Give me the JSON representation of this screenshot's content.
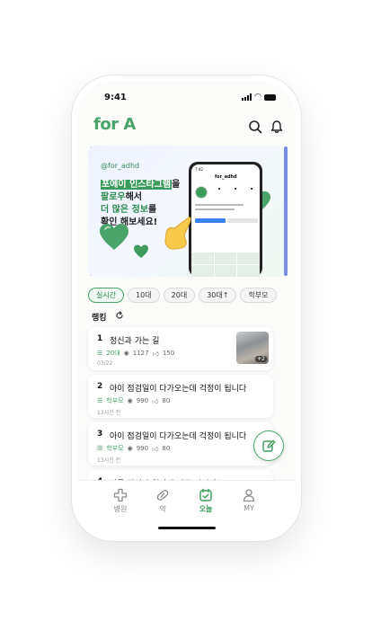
{
  "status": {
    "time": "9:41"
  },
  "header": {
    "logo": "for A"
  },
  "banner": {
    "handle": "@for_adhd",
    "line1_highlight": "포에이 인스타그램",
    "line1_rest": "을",
    "line2_highlight": "팔로우",
    "line2_rest": "해서",
    "line3_highlight1": "더 많은 정보",
    "line3_rest": "를",
    "line4": "확인 해보세요!",
    "mock_time": "7:42",
    "mock_user": "for_adhd"
  },
  "filters": {
    "items": [
      "실시간",
      "10대",
      "20대",
      "30대↑",
      "학부모"
    ],
    "selected": "실시간"
  },
  "ranking": {
    "title": "랭킹",
    "items": [
      {
        "rank": "1",
        "title": "정신과 가는 길",
        "category": "20대",
        "views": "1127",
        "likes": "150",
        "time": "03/22",
        "thumb_count": "+2"
      },
      {
        "rank": "2",
        "title": "아이 점검일이 다가오는데 걱정이 됩니다",
        "category": "학부모",
        "views": "990",
        "likes": "80",
        "time": "13시간 전"
      },
      {
        "rank": "3",
        "title": "아이 점검일이 다가오는데 걱정이 됩니다",
        "category": "학부모",
        "views": "990",
        "likes": "80",
        "time": "13시간 전"
      },
      {
        "rank": "4",
        "title": "다들 정신과 얼마나 자주 가시나요?..."
      }
    ]
  },
  "tabbar": {
    "items": [
      "병원",
      "약",
      "오늘",
      "MY"
    ],
    "active": "오늘"
  },
  "colors": {
    "accent": "#4aa36a",
    "accent_dark": "#2e8b4f"
  }
}
